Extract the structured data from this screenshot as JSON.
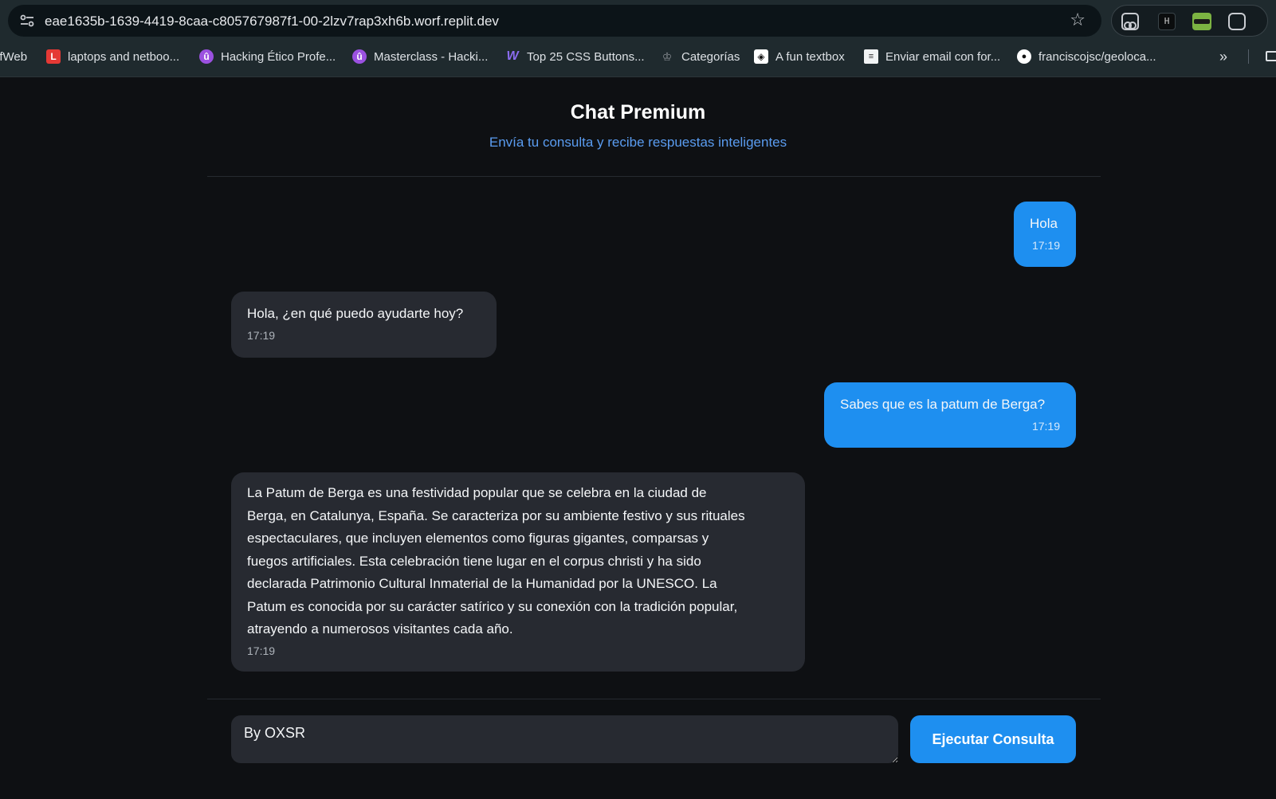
{
  "browser": {
    "url": "eae1635b-1639-4419-8caa-c805767987f1-00-2lzv7rap3xh6b.worf.replit.dev",
    "bookmarks": [
      {
        "label": "lfWeb",
        "icon": "none"
      },
      {
        "label": "laptops and netboo...",
        "icon": "letter-l-icon"
      },
      {
        "label": "Hacking Ético Profe...",
        "icon": "udemy-icon"
      },
      {
        "label": "Masterclass - Hacki...",
        "icon": "udemy-icon"
      },
      {
        "label": "Top 25 CSS Buttons...",
        "icon": "w-logo-icon"
      },
      {
        "label": "Categorías",
        "icon": "crown-icon"
      },
      {
        "label": "A fun textbox",
        "icon": "codepen-icon"
      },
      {
        "label": "Enviar email con for...",
        "icon": "document-icon"
      },
      {
        "label": "franciscojsc/geoloca...",
        "icon": "github-icon"
      }
    ],
    "extension_badge": "H"
  },
  "header": {
    "title": "Chat Premium",
    "subtitle": "Envía tu consulta y recibe respuestas inteligentes"
  },
  "messages": [
    {
      "role": "user",
      "text": "Hola",
      "time": "17:19"
    },
    {
      "role": "assistant",
      "text": "Hola, ¿en qué puedo ayudarte hoy?",
      "time": "17:19"
    },
    {
      "role": "user",
      "text": "Sabes que es la patum de Berga?",
      "time": "17:19"
    },
    {
      "role": "assistant",
      "lines": [
        "La Patum de Berga es una festividad popular que se celebra en la ciudad de",
        "Berga, en Catalunya, España. Se caracteriza por su ambiente festivo y sus rituales",
        "espectaculares, que incluyen elementos como figuras gigantes, comparsas y",
        "fuegos artificiales. Esta celebración tiene lugar en el corpus christi y ha sido",
        "declarada Patrimonio Cultural Inmaterial de la Humanidad por la UNESCO. La",
        "Patum es conocida por su carácter satírico y su conexión con la tradición popular,",
        "atrayendo a numerosos visitantes cada año."
      ],
      "time": "17:19"
    }
  ],
  "composer": {
    "value": "By OXSR",
    "submit_label": "Ejecutar Consulta"
  },
  "colors": {
    "accent": "#1e8ff0",
    "background": "#0e1013",
    "bot_bubble": "#272a31",
    "subtitle": "#5a9cf0"
  }
}
